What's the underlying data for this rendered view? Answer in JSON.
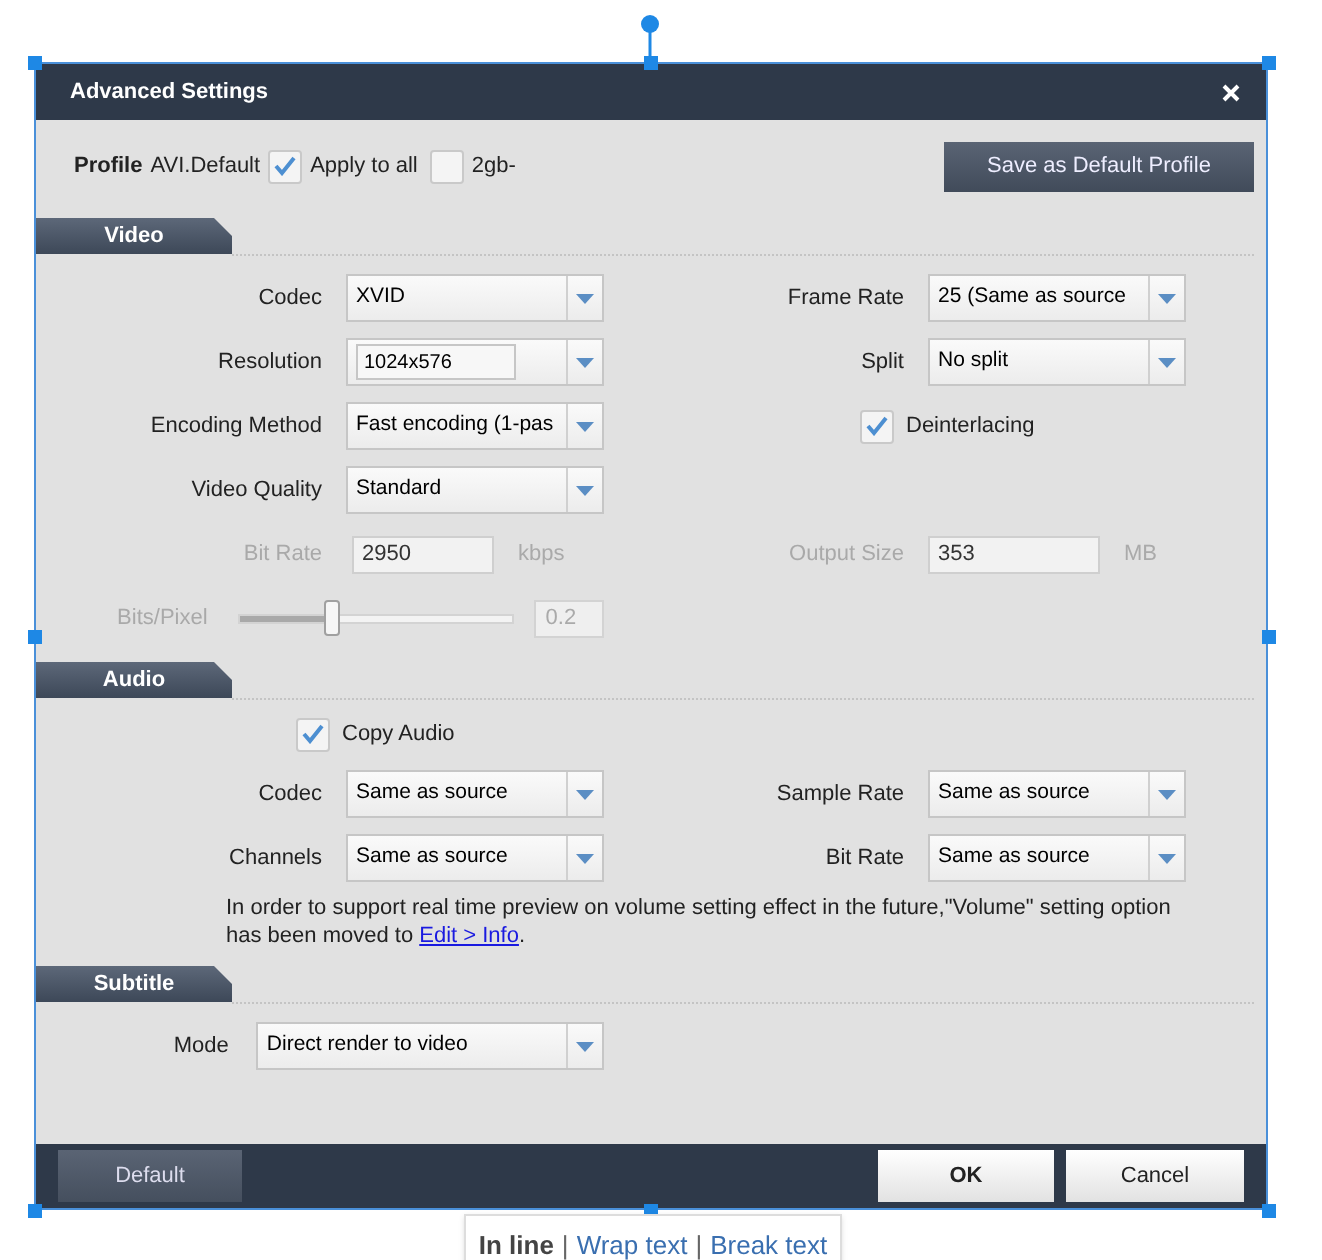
{
  "dialog": {
    "title": "Advanced Settings"
  },
  "profile": {
    "label": "Profile",
    "value": "AVI.Default",
    "options": [
      {
        "label": "Apply to all",
        "checked": true
      },
      {
        "label": "2gb-",
        "checked": false
      }
    ],
    "save_button": "Save as Default Profile"
  },
  "sections": [
    {
      "title": "Video",
      "rows": [
        {
          "left": {
            "kind": "select",
            "label": "Codec",
            "value": "XVID"
          },
          "right": {
            "kind": "select",
            "label": "Frame Rate",
            "value": "25 (Same as source"
          }
        },
        {
          "left": {
            "kind": "editable",
            "label": "Resolution",
            "value": "1024x576"
          },
          "right": {
            "kind": "select",
            "label": "Split",
            "value": "No split"
          }
        },
        {
          "left": {
            "kind": "select",
            "label": "Encoding Method",
            "value": "Fast encoding (1-pas"
          },
          "right": {
            "kind": "checkbox",
            "label": "Deinterlacing",
            "checked": true
          }
        },
        {
          "left": {
            "kind": "select",
            "label": "Video Quality",
            "value": "Standard"
          }
        },
        {
          "left": {
            "kind": "input",
            "label": "Bit Rate",
            "value": "2950",
            "unit": "kbps",
            "disabled": true
          },
          "right": {
            "kind": "input",
            "label": "Output Size",
            "value": "353",
            "unit": "MB",
            "disabled": true
          }
        },
        {
          "left": {
            "kind": "slider",
            "label": "Bits/Pixel",
            "level": 0.34,
            "reading": "0.2",
            "disabled": true
          }
        }
      ]
    },
    {
      "title": "Audio",
      "rows": [
        {
          "left": {
            "kind": "checkbox",
            "label": "Copy Audio",
            "checked": true
          }
        },
        {
          "left": {
            "kind": "select",
            "label": "Codec",
            "value": "Same as source"
          },
          "right": {
            "kind": "select",
            "label": "Sample Rate",
            "value": "Same as source"
          }
        },
        {
          "left": {
            "kind": "select",
            "label": "Channels",
            "value": "Same as source"
          },
          "right": {
            "kind": "select",
            "label": "Bit Rate",
            "value": "Same as source"
          }
        }
      ],
      "note": {
        "text": "In order to support real time preview on volume setting effect in the future,\"Volume\" setting option has been moved to ",
        "link": "Edit > Info",
        "after": "."
      }
    },
    {
      "title": "Subtitle",
      "rows": [
        {
          "left": {
            "kind": "wide_select",
            "label": "Mode",
            "value": "Direct render to video"
          }
        }
      ]
    }
  ],
  "footer": {
    "default_button": "Default",
    "ok_button": "OK",
    "cancel_button": "Cancel"
  },
  "image_toolbar": {
    "separator": "|",
    "items": [
      {
        "label": "In line",
        "selected": true
      },
      {
        "label": "Wrap text",
        "selected": false
      },
      {
        "label": "Break text",
        "selected": false
      }
    ]
  }
}
